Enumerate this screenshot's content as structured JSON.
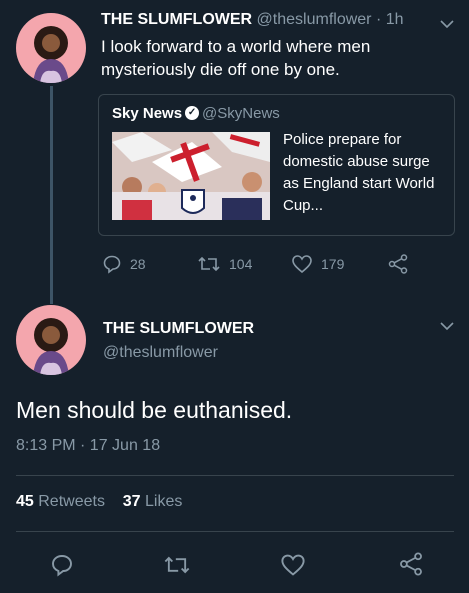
{
  "tweet1": {
    "name": "THE SLUMFLOWER",
    "handle": "@theslumflower",
    "time": "· 1h",
    "text": "I look forward to a world where men mysteriously die off one by one.",
    "quote": {
      "name": "Sky News",
      "handle": "@SkyNews",
      "text": "Police prepare for domestic abuse surge as England start World Cup..."
    },
    "replies": "28",
    "retweets": "104",
    "likes": "179"
  },
  "tweet2": {
    "name": "THE SLUMFLOWER",
    "handle": "@theslumflower",
    "text": "Men should be euthanised.",
    "timestamp": "8:13 PM · 17 Jun 18",
    "retweet_count": "45",
    "retweet_label": "Retweets",
    "like_count": "37",
    "like_label": "Likes"
  },
  "colors": {
    "background": "#15202b",
    "muted": "#8899a6",
    "border": "#38444d",
    "avatar_bg": "#f4a6ad"
  }
}
